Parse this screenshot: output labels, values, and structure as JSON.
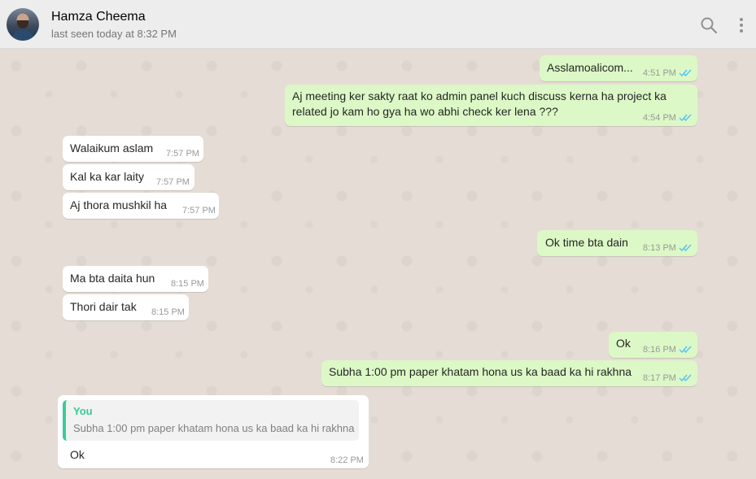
{
  "header": {
    "name": "Hamza Cheema",
    "status": "last seen today at 8:32 PM"
  },
  "messages": [
    {
      "dir": "out",
      "text": "Asslamoalicom...",
      "time": "4:51 PM",
      "read": true
    },
    {
      "dir": "out",
      "text_lines": [
        "Aj meeting ker sakty raat ko admin panel kuch discuss kerna ha project ka",
        "related jo kam ho gya ha wo abhi check ker lena ???"
      ],
      "time": "4:54 PM",
      "read": true
    },
    {
      "dir": "in",
      "text": "Walaikum aslam",
      "time": "7:57 PM"
    },
    {
      "dir": "in",
      "text": "Kal ka kar laity",
      "time": "7:57 PM"
    },
    {
      "dir": "in",
      "text": "Aj thora mushkil ha",
      "time": "7:57 PM"
    },
    {
      "dir": "out",
      "text": "Ok time bta dain",
      "time": "8:13 PM",
      "read": true
    },
    {
      "dir": "in",
      "text": "Ma bta daita hun",
      "time": "8:15 PM"
    },
    {
      "dir": "in",
      "text": "Thori dair tak",
      "time": "8:15 PM"
    },
    {
      "dir": "out",
      "text": "Ok",
      "time": "8:16 PM",
      "read": true
    },
    {
      "dir": "out",
      "text": "Subha 1:00 pm paper khatam hona us ka baad ka hi rakhna",
      "time": "8:17 PM",
      "read": true
    },
    {
      "dir": "in",
      "text": "Ok",
      "time": "8:22 PM",
      "quote": {
        "author": "You",
        "text": "Subha 1:00 pm paper khatam hona us ka baad ka hi rakhna"
      }
    }
  ],
  "colors": {
    "outgoing_bubble": "#dcf8c6",
    "incoming_bubble": "#ffffff",
    "read_tick": "#4fc3f7",
    "quote_accent": "#35cd96",
    "chat_background": "#e5ddd5"
  },
  "icons": [
    "search-icon",
    "menu-dots-icon",
    "double-check-icon"
  ]
}
